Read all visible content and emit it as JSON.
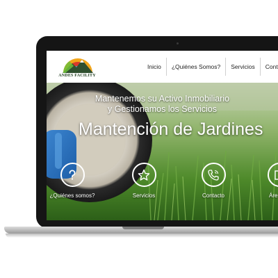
{
  "brand": {
    "name": "ANDES FACILITY"
  },
  "nav": {
    "items": [
      "Inicio",
      "¿Quiénes Somos?",
      "Servicios",
      "Contá"
    ]
  },
  "hero": {
    "subtitle_line1": "Mantenemos su Activo Inmobiliario",
    "subtitle_line2": "y Gestionamos los Servicios",
    "title": "Mantención de Jardines"
  },
  "features": [
    {
      "label": "¿Quiénes somos?",
      "icon": "question-icon"
    },
    {
      "label": "Servicios",
      "icon": "star-icon"
    },
    {
      "label": "Contacto",
      "icon": "phone-icon"
    },
    {
      "label": "Áre",
      "icon": "area-icon"
    }
  ],
  "colors": {
    "icon_stroke": "#ffffff",
    "grass": "#4c8a2c",
    "laptop_bezel": "#151515"
  }
}
